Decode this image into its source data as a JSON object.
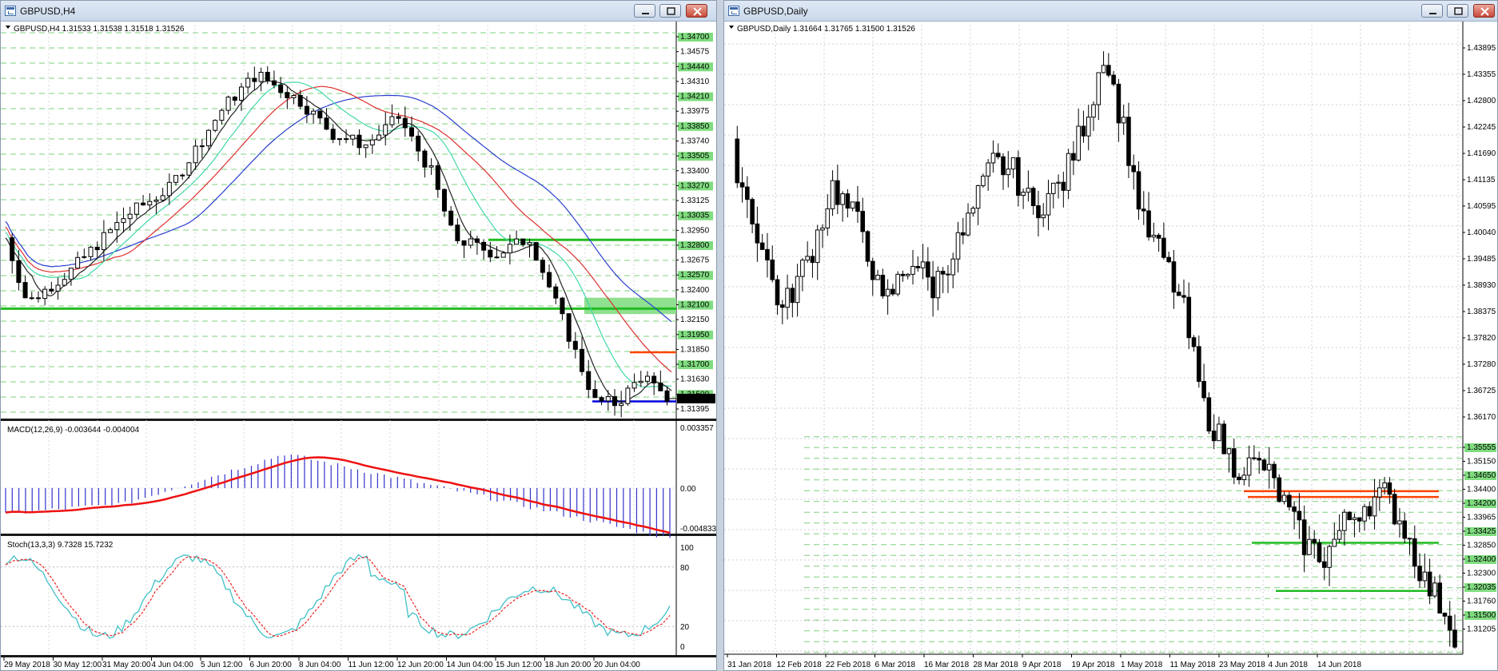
{
  "left_window": {
    "title": "GBPUSD,H4",
    "header": "GBPUSD,H4  1.31533 1.31538 1.31518 1.31526",
    "price_axis": [
      "1.34700",
      "1.34575",
      "1.34440",
      "1.34310",
      "1.34210",
      "1.33975",
      "1.33850",
      "1.33740",
      "1.33505",
      "1.33400",
      "1.33270",
      "1.33125",
      "1.33035",
      "1.32950",
      "1.32800",
      "1.32675",
      "1.32570",
      "1.32400",
      "1.32100",
      "1.32150",
      "1.31950",
      "1.31850",
      "1.31700",
      "1.31630",
      "1.31500",
      "1.31395"
    ],
    "price_range": [
      1.3135,
      1.3495
    ],
    "current_price": "1.31526",
    "macd": {
      "label": "MACD(12,26,9) -0.003644 -0.004004",
      "axis": [
        "0.003357",
        "0.00",
        "-0.004833"
      ]
    },
    "stoch": {
      "label": "Stoch(13,3,3) 9.7328 15.7232",
      "axis": [
        "100",
        "80",
        "20",
        "0"
      ]
    },
    "dates": [
      "29 May 2018",
      "30 May 12:00",
      "31 May 20:00",
      "4 Jun 04:00",
      "5 Jun 12:00",
      "6 Jun 20:00",
      "8 Jun 04:00",
      "11 Jun 12:00",
      "12 Jun 20:00",
      "14 Jun 04:00",
      "15 Jun 12:00",
      "18 Jun 20:00",
      "20 Jun 04:00"
    ],
    "levels": [
      {
        "price": 1.3298,
        "color": "#22bb22"
      },
      {
        "price": 1.3235,
        "color": "#22bb22"
      },
      {
        "price": 1.3195,
        "color": "#ff4400"
      },
      {
        "price": 1.315,
        "color": "#0000dd"
      }
    ],
    "zone": {
      "top": 1.3245,
      "bottom": 1.323,
      "color": "#8fe08f"
    }
  },
  "right_window": {
    "title": "GBPUSD,Daily",
    "header": "GBPUSD,Daily  1.31664 1.31765 1.31500 1.31526",
    "price_axis": [
      "1.43895",
      "1.43355",
      "1.42800",
      "1.42245",
      "1.41690",
      "1.41135",
      "1.40595",
      "1.40040",
      "1.39485",
      "1.38930",
      "1.38375",
      "1.37820",
      "1.37280",
      "1.36725",
      "1.36170",
      "1.35555",
      "1.35150",
      "1.34650",
      "1.34400",
      "1.34200",
      "1.33965",
      "1.33425",
      "1.32850",
      "1.32400",
      "1.32300",
      "1.32035",
      "1.31760",
      "1.31500",
      "1.31205"
    ],
    "price_range": [
      1.3112,
      1.4415
    ],
    "current_price": "1.31526",
    "dates": [
      "31 Jan 2018",
      "12 Feb 2018",
      "22 Feb 2018",
      "6 Mar 2018",
      "16 Mar 2018",
      "28 Mar 2018",
      "9 Apr 2018",
      "19 Apr 2018",
      "1 May 2018",
      "11 May 2018",
      "23 May 2018",
      "4 Jun 2018",
      "14 Jun 2018"
    ],
    "levels": [
      {
        "price": 1.3447,
        "color": "#ff4400"
      },
      {
        "price": 1.3435,
        "color": "#ff4400"
      },
      {
        "price": 1.334,
        "color": "#22bb22"
      },
      {
        "price": 1.324,
        "color": "#22bb22"
      }
    ]
  },
  "colors": {
    "grid_green": "#7fd07f",
    "ma_blue": "#2a3fd0",
    "ma_red": "#e03030",
    "ma_teal": "#40d8a8",
    "ma_black": "#222222",
    "macd_hist": "#3333cc",
    "macd_signal": "#ee1111",
    "stoch_main": "#40c0c8",
    "stoch_signal": "#ee2222"
  },
  "icons": [
    "chart-window-icon",
    "minimize-icon",
    "restore-icon",
    "close-icon"
  ]
}
